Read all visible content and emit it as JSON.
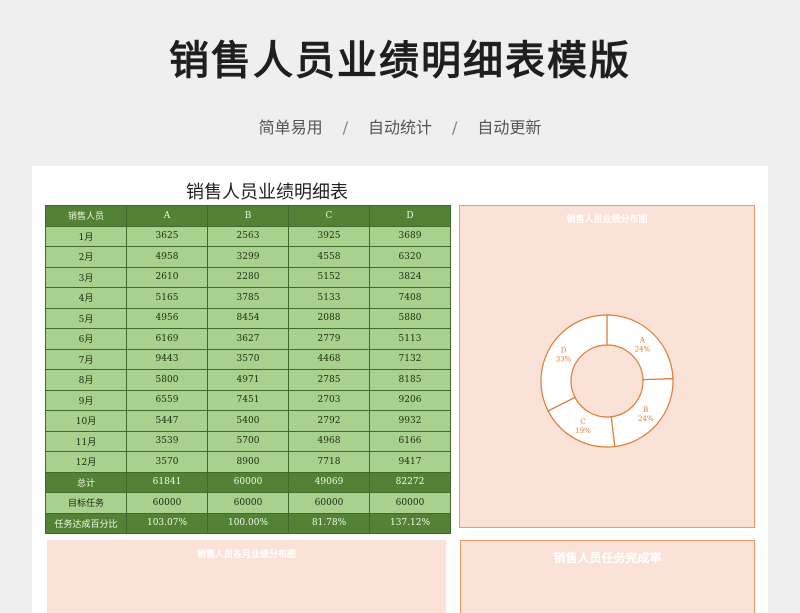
{
  "header": {
    "title": "销售人员业绩明细表模版"
  },
  "subtitle": {
    "items": [
      "简单易用",
      "自动统计",
      "自动更新"
    ],
    "separator": "/"
  },
  "sheet": {
    "title": "销售人员业绩明细表",
    "columns": [
      "销售人员",
      "A",
      "B",
      "C",
      "D"
    ],
    "rows": [
      [
        "1月",
        "3625",
        "2563",
        "3925",
        "3689"
      ],
      [
        "2月",
        "4958",
        "3299",
        "4558",
        "6320"
      ],
      [
        "3月",
        "2610",
        "2280",
        "5152",
        "3824"
      ],
      [
        "4月",
        "5165",
        "3785",
        "5133",
        "7408"
      ],
      [
        "5月",
        "4956",
        "8454",
        "2088",
        "5880"
      ],
      [
        "6月",
        "6169",
        "3627",
        "2779",
        "5113"
      ],
      [
        "7月",
        "9443",
        "3570",
        "4468",
        "7132"
      ],
      [
        "8月",
        "5800",
        "4971",
        "2785",
        "8185"
      ],
      [
        "9月",
        "6559",
        "7451",
        "2703",
        "9206"
      ],
      [
        "10月",
        "5447",
        "5400",
        "2792",
        "9932"
      ],
      [
        "11月",
        "3539",
        "5700",
        "4968",
        "6166"
      ],
      [
        "12月",
        "3570",
        "8900",
        "7718",
        "9417"
      ]
    ],
    "total_row": [
      "总计",
      "61841",
      "60000",
      "49069",
      "82272"
    ],
    "target_row": [
      "目标任务",
      "60000",
      "60000",
      "60000",
      "60000"
    ],
    "rate_row": [
      "任务达成百分比",
      "103.07%",
      "100.00%",
      "81.78%",
      "137.12%"
    ]
  },
  "panels": {
    "pie_title": "销售人员业绩分布图",
    "bottom_left_title": "销售人员各月业绩分布图",
    "bottom_right_title": "销售人员任务完成率"
  },
  "colors": {
    "dark_green": "#548235",
    "light_green": "#a9d18e",
    "panel_bg": "#fbe2d6",
    "accent_orange": "#e07b39"
  },
  "chart_data": {
    "type": "pie",
    "title": "销售人员业绩分布图",
    "donut": true,
    "categories": [
      "A",
      "B",
      "C",
      "D"
    ],
    "values": [
      61841,
      60000,
      49069,
      82272
    ],
    "labels": [
      "A\n24%",
      "B\n24%",
      "C\n19%",
      "D\n33%"
    ],
    "label_name": [
      "A",
      "B",
      "C",
      "D"
    ],
    "label_pct": [
      "24%",
      "24%",
      "19%",
      "33%"
    ]
  }
}
